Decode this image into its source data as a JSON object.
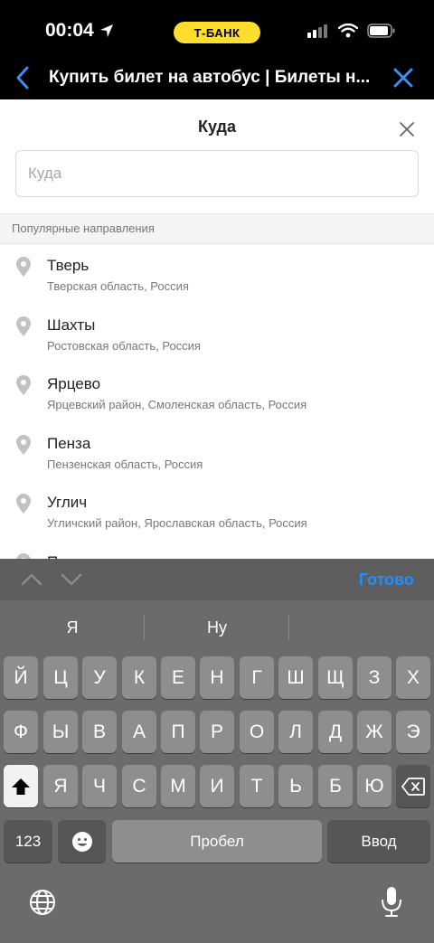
{
  "status_bar": {
    "time": "00:04",
    "carrier_badge": "Т-БАНК"
  },
  "browser": {
    "title": "Купить билет на автобус | Билеты н..."
  },
  "sheet": {
    "title": "Куда",
    "search_placeholder": "Куда",
    "section_header": "Популярные направления",
    "destinations": [
      {
        "name": "Тверь",
        "region": "Тверская область, Россия"
      },
      {
        "name": "Шахты",
        "region": "Ростовская область, Россия"
      },
      {
        "name": "Ярцево",
        "region": "Ярцевский район, Смоленская область, Россия"
      },
      {
        "name": "Пенза",
        "region": "Пензенская область, Россия"
      },
      {
        "name": "Углич",
        "region": "Угличский район, Ярославская область, Россия"
      },
      {
        "name": "П",
        "region": ""
      }
    ]
  },
  "keyboard": {
    "done_label": "Готово",
    "suggestions": [
      "Я",
      "Ну",
      ""
    ],
    "row1": [
      "Й",
      "Ц",
      "У",
      "К",
      "Е",
      "Н",
      "Г",
      "Ш",
      "Щ",
      "З",
      "Х"
    ],
    "row2": [
      "Ф",
      "Ы",
      "В",
      "А",
      "П",
      "Р",
      "О",
      "Л",
      "Д",
      "Ж",
      "Э"
    ],
    "row3": [
      "Я",
      "Ч",
      "С",
      "М",
      "И",
      "Т",
      "Ь",
      "Б",
      "Ю"
    ],
    "numbers_label": "123",
    "space_label": "Пробел",
    "return_label": "Ввод"
  },
  "colors": {
    "accent": "#1e90ff",
    "badge": "#ffdd2d"
  }
}
